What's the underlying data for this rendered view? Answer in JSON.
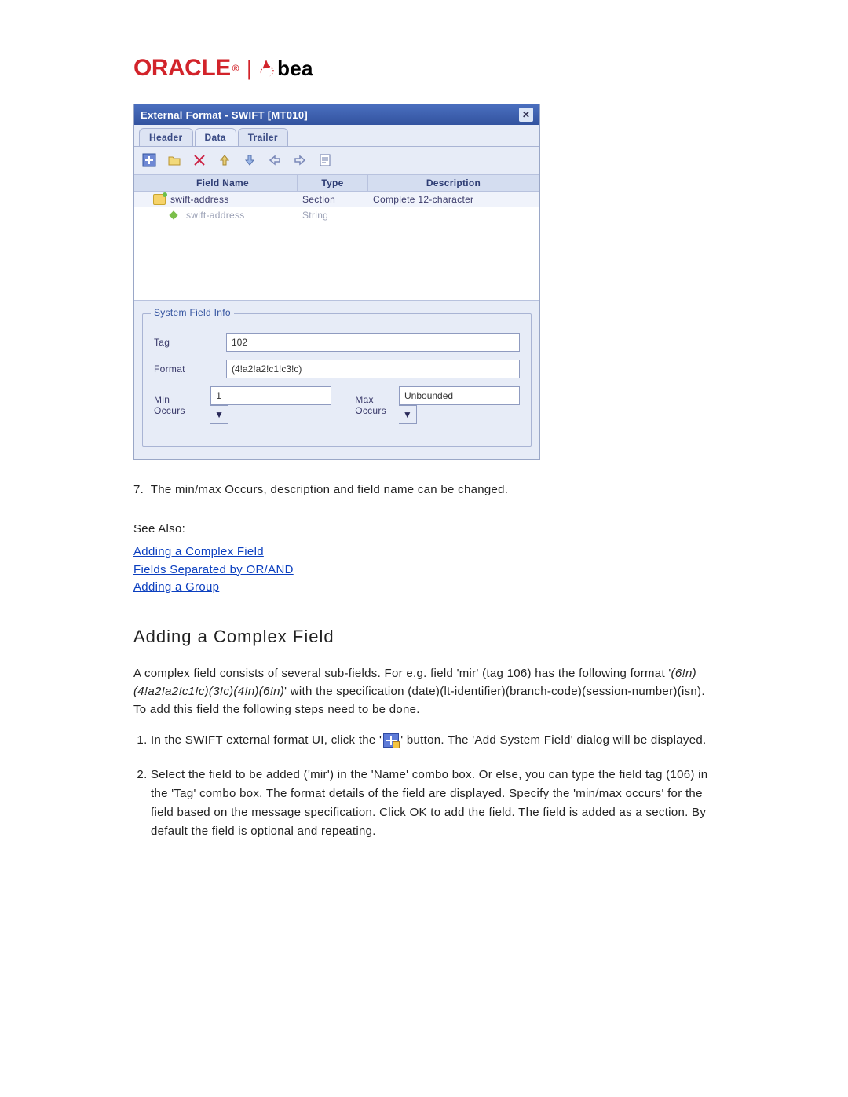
{
  "logo": {
    "oracle": "ORACLE",
    "sep": "|",
    "bea": "bea"
  },
  "panel": {
    "title": "External Format - SWIFT [MT010]",
    "tabs": [
      "Header",
      "Data",
      "Trailer"
    ],
    "active_tab": 1,
    "columns": [
      "Field Name",
      "Type",
      "Description"
    ],
    "rows": [
      {
        "name": "swift-address",
        "type": "Section",
        "desc": "Complete 12-character",
        "level": 0,
        "selected": true,
        "kind": "section"
      },
      {
        "name": "swift-address",
        "type": "String",
        "desc": "",
        "level": 1,
        "selected": false,
        "kind": "leaf",
        "grayed": true
      }
    ],
    "fieldset_legend": "System Field Info",
    "tag_label": "Tag",
    "tag_value": "102",
    "format_label": "Format",
    "format_value": "(4!a2!a2!c1!c3!c)",
    "min_label": "Min Occurs",
    "min_value": "1",
    "max_label": "Max Occurs",
    "max_value": "Unbounded"
  },
  "body": {
    "item7": "The min/max Occurs, description and field name can be changed.",
    "see_also_label": "See Also:",
    "links": [
      "Adding a Complex Field",
      "Fields Separated by OR/AND",
      "Adding a Group"
    ],
    "heading": "Adding a Complex Field",
    "para1_a": "A complex field consists of several sub-fields. For e.g. field 'mir' (tag 106) has the following format '",
    "para1_fmt": "(6!n)(4!a2!a2!c1!c)(3!c)(4!n)(6!n)",
    "para1_b": "' with the specification (date)(lt-identifier)(branch-code)(session-number)(isn). To add this field the following steps need to be done.",
    "step1_a": "In the SWIFT external format UI, click the '",
    "step1_b": "' button. The 'Add System Field' dialog will be displayed.",
    "step2": "Select the field to be added ('mir') in the 'Name' combo box. Or else, you can type the field tag (106) in the 'Tag' combo box. The format details of the field are displayed. Specify the 'min/max occurs' for the field based on the message specification. Click OK to add the field. The field is added as a section. By default the field is optional and repeating."
  }
}
